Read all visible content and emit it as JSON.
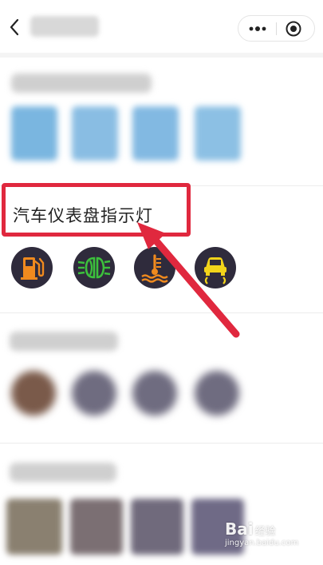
{
  "header": {
    "back_icon": "chevron-left-icon",
    "menu_icons": [
      "more-dots-icon",
      "close-target-icon"
    ]
  },
  "highlighted_section": {
    "title": "汽车仪表盘指示灯",
    "highlight_color": "#e0283e",
    "icons": [
      {
        "name": "fuel-warning-icon",
        "color": "#f08a1e"
      },
      {
        "name": "fog-light-icon",
        "color": "#3cc03c"
      },
      {
        "name": "coolant-temperature-icon",
        "color": "#f08a1e"
      },
      {
        "name": "traction-control-icon",
        "color": "#f2d41a"
      }
    ]
  },
  "watermark": {
    "brand": "Bai",
    "brand_suffix": "经验",
    "domain": "jingyan.baidu.com"
  }
}
